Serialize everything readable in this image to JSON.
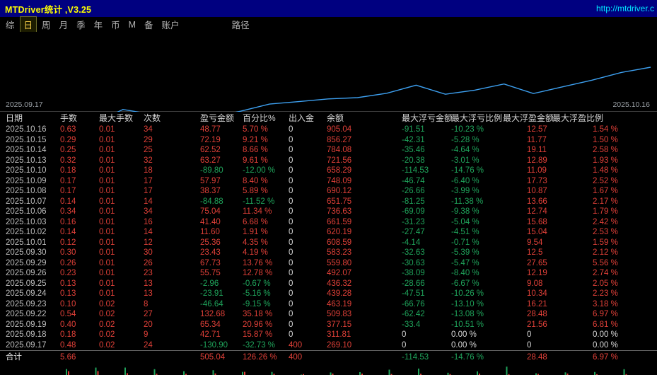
{
  "window": {
    "title": "MTDriver统计 ,V3.25",
    "url": "http://mtdriver.c"
  },
  "menu": {
    "items": [
      "综",
      "日",
      "周",
      "月",
      "季",
      "年",
      "币",
      "M",
      "备",
      "账户"
    ],
    "selected": "日",
    "path_item": "路径"
  },
  "chart": {
    "start_label": "2025.09.17",
    "end_label": "2025.10.16"
  },
  "chart_data": {
    "type": "line",
    "title": "",
    "x": [
      "2025.09.17",
      "2025.09.17",
      "2025.09.18",
      "2025.09.19",
      "2025.09.22",
      "2025.09.23",
      "2025.09.24",
      "2025.09.25",
      "2025.09.26",
      "2025.09.29",
      "2025.09.30",
      "2025.10.01",
      "2025.10.02",
      "2025.10.03",
      "2025.10.06",
      "2025.10.07",
      "2025.10.08",
      "2025.10.09",
      "2025.10.10",
      "2025.10.13",
      "2025.10.14",
      "2025.10.15",
      "2025.10.16"
    ],
    "series": [
      {
        "name": "余额",
        "values": [
          400,
          269.1,
          311.81,
          377.15,
          509.83,
          463.19,
          439.28,
          436.32,
          492.07,
          559.8,
          583.23,
          608.59,
          620.19,
          661.59,
          736.63,
          651.75,
          690.12,
          748.09,
          658.29,
          721.56,
          784.08,
          856.27,
          905.04
        ]
      }
    ],
    "ylim": [
      269.1,
      905.04
    ],
    "x_axis_labels_visible": [
      "2025.09.17",
      "2025.10.16"
    ],
    "line_color": "#3da0f0",
    "grid": false,
    "legend": false,
    "bottom_strip": {
      "type": "bar",
      "partial": true,
      "note": "per-day bars cut off at bottom edge"
    }
  },
  "table": {
    "headers": [
      "日期",
      "手数",
      "最大手数",
      "次数",
      "盈亏金额",
      "百分比%",
      "出入金",
      "余额",
      "最大浮亏金额",
      "最大浮亏比例",
      "最大浮盈金额",
      "最大浮盈比例"
    ],
    "rows": [
      [
        "2025.10.16",
        "0.63",
        "0.01",
        "34",
        "48.77",
        "5.70 %",
        "0",
        "905.04",
        "-91.51",
        "-10.23 %",
        "12.57",
        "1.54 %"
      ],
      [
        "2025.10.15",
        "0.29",
        "0.01",
        "29",
        "72.19",
        "9.21 %",
        "0",
        "856.27",
        "-42.31",
        "-5.28 %",
        "11.77",
        "1.50 %"
      ],
      [
        "2025.10.14",
        "0.25",
        "0.01",
        "25",
        "62.52",
        "8.66 %",
        "0",
        "784.08",
        "-35.46",
        "-4.64 %",
        "19.11",
        "2.58 %"
      ],
      [
        "2025.10.13",
        "0.32",
        "0.01",
        "32",
        "63.27",
        "9.61 %",
        "0",
        "721.56",
        "-20.38",
        "-3.01 %",
        "12.89",
        "1.93 %"
      ],
      [
        "2025.10.10",
        "0.18",
        "0.01",
        "18",
        "-89.80",
        "-12.00 %",
        "0",
        "658.29",
        "-114.53",
        "-14.76 %",
        "11.09",
        "1.48 %"
      ],
      [
        "2025.10.09",
        "0.17",
        "0.01",
        "17",
        "57.97",
        "8.40 %",
        "0",
        "748.09",
        "-46.74",
        "-6.40 %",
        "17.73",
        "2.52 %"
      ],
      [
        "2025.10.08",
        "0.17",
        "0.01",
        "17",
        "38.37",
        "5.89 %",
        "0",
        "690.12",
        "-26.66",
        "-3.99 %",
        "10.87",
        "1.67 %"
      ],
      [
        "2025.10.07",
        "0.14",
        "0.01",
        "14",
        "-84.88",
        "-11.52 %",
        "0",
        "651.75",
        "-81.25",
        "-11.38 %",
        "13.66",
        "2.17 %"
      ],
      [
        "2025.10.06",
        "0.34",
        "0.01",
        "34",
        "75.04",
        "11.34 %",
        "0",
        "736.63",
        "-69.09",
        "-9.38 %",
        "12.74",
        "1.79 %"
      ],
      [
        "2025.10.03",
        "0.16",
        "0.01",
        "16",
        "41.40",
        "6.68 %",
        "0",
        "661.59",
        "-31.23",
        "-5.04 %",
        "15.68",
        "2.42 %"
      ],
      [
        "2025.10.02",
        "0.14",
        "0.01",
        "14",
        "11.60",
        "1.91 %",
        "0",
        "620.19",
        "-27.47",
        "-4.51 %",
        "15.04",
        "2.53 %"
      ],
      [
        "2025.10.01",
        "0.12",
        "0.01",
        "12",
        "25.36",
        "4.35 %",
        "0",
        "608.59",
        "-4.14",
        "-0.71 %",
        "9.54",
        "1.59 %"
      ],
      [
        "2025.09.30",
        "0.30",
        "0.01",
        "30",
        "23.43",
        "4.19 %",
        "0",
        "583.23",
        "-32.63",
        "-5.39 %",
        "12.5",
        "2.12 %"
      ],
      [
        "2025.09.29",
        "0.26",
        "0.01",
        "26",
        "67.73",
        "13.76 %",
        "0",
        "559.80",
        "-30.63",
        "-5.47 %",
        "27.65",
        "5.56 %"
      ],
      [
        "2025.09.26",
        "0.23",
        "0.01",
        "23",
        "55.75",
        "12.78 %",
        "0",
        "492.07",
        "-38.09",
        "-8.40 %",
        "12.19",
        "2.74 %"
      ],
      [
        "2025.09.25",
        "0.13",
        "0.01",
        "13",
        "-2.96",
        "-0.67 %",
        "0",
        "436.32",
        "-28.66",
        "-6.67 %",
        "9.08",
        "2.05 %"
      ],
      [
        "2025.09.24",
        "0.13",
        "0.01",
        "13",
        "-23.91",
        "-5.16 %",
        "0",
        "439.28",
        "-47.51",
        "-10.26 %",
        "10.34",
        "2.23 %"
      ],
      [
        "2025.09.23",
        "0.10",
        "0.02",
        "8",
        "-46.64",
        "-9.15 %",
        "0",
        "463.19",
        "-66.76",
        "-13.10 %",
        "16.21",
        "3.18 %"
      ],
      [
        "2025.09.22",
        "0.54",
        "0.02",
        "27",
        "132.68",
        "35.18 %",
        "0",
        "509.83",
        "-62.42",
        "-13.08 %",
        "28.48",
        "6.97 %"
      ],
      [
        "2025.09.19",
        "0.40",
        "0.02",
        "20",
        "65.34",
        "20.96 %",
        "0",
        "377.15",
        "-33.4",
        "-10.51 %",
        "21.56",
        "6.81 %"
      ],
      [
        "2025.09.18",
        "0.18",
        "0.02",
        "9",
        "42.71",
        "15.87 %",
        "0",
        "311.81",
        "0",
        "0.00 %",
        "0",
        "0.00 %"
      ],
      [
        "2025.09.17",
        "0.48",
        "0.02",
        "24",
        "-130.90",
        "-32.73 %",
        "400",
        "269.10",
        "0",
        "0.00 %",
        "0",
        "0.00 %"
      ]
    ],
    "total": {
      "label": "合计",
      "lots": "5.66",
      "pnl": "505.04",
      "pct": "126.26 %",
      "cash": "400",
      "fl_amt": "-114.53",
      "fl_pct": "-14.76 %",
      "fp_amt": "28.48",
      "fp_pct": "6.97 %"
    }
  },
  "colors": {
    "titlebar_bg": "#000080",
    "title_text": "#ffff00",
    "url_text": "#00e5ff",
    "gain": "#e04038",
    "loss": "#1fa45b",
    "date_text": "#bfbfbf",
    "neutral_text": "#d9d9d9",
    "header_text": "#d4d4d4",
    "chart_line": "#3da0f0"
  }
}
